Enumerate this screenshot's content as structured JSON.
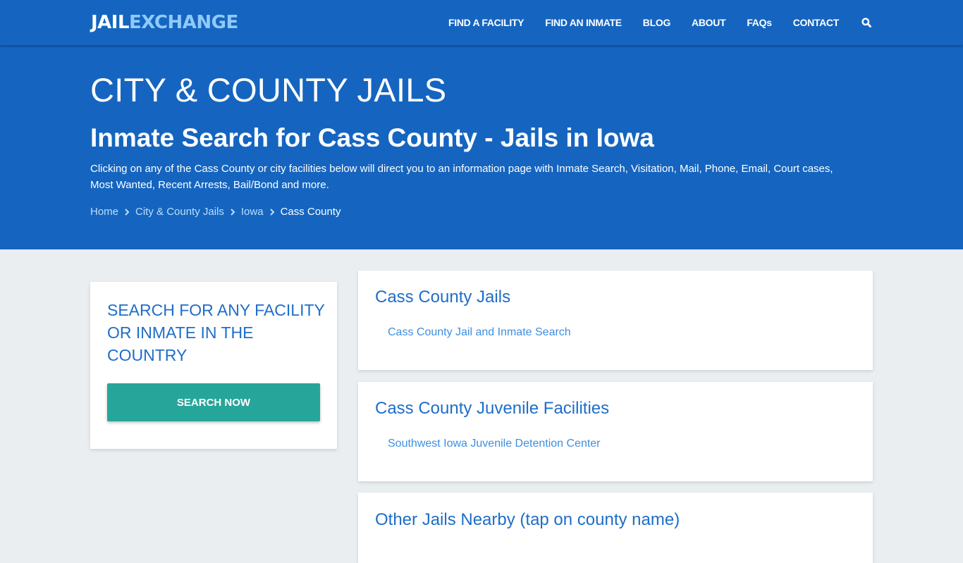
{
  "header": {
    "logo_part1": "JAIL",
    "logo_part2": "EXCHANGE",
    "nav": [
      {
        "label": "FIND A FACILITY"
      },
      {
        "label": "FIND AN INMATE"
      },
      {
        "label": "BLOG"
      },
      {
        "label": "ABOUT"
      },
      {
        "label": "FAQs"
      },
      {
        "label": "CONTACT"
      }
    ],
    "search_icon": "search-icon"
  },
  "hero": {
    "title": "CITY & COUNTY JAILS",
    "subtitle": "Inmate Search for Cass County - Jails in Iowa",
    "description": "Clicking on any of the Cass County or city facilities below will direct you to an information page with Inmate Search, Visitation, Mail, Phone, Email, Court cases, Most Wanted, Recent Arrests, Bail/Bond and more.",
    "breadcrumb": [
      {
        "label": "Home"
      },
      {
        "label": "City & County Jails"
      },
      {
        "label": "Iowa"
      },
      {
        "label": "Cass County"
      }
    ]
  },
  "sidebar": {
    "heading": "SEARCH FOR ANY FACILITY OR INMATE IN THE COUNTRY",
    "button_label": "SEARCH NOW"
  },
  "sections": [
    {
      "title": "Cass County Jails",
      "links": [
        "Cass County Jail and Inmate Search"
      ]
    },
    {
      "title": "Cass County Juvenile Facilities",
      "links": [
        "Southwest Iowa Juvenile Detention Center"
      ]
    },
    {
      "title": "Other Jails Nearby (tap on county name)",
      "links": []
    }
  ],
  "colors": {
    "brand_blue": "#1565c0",
    "logo_accent": "#90caf9",
    "heading_blue": "#1e6ec8",
    "link_blue": "#3d8fe0",
    "button_teal": "#26a69a",
    "page_bg": "#eaeef1"
  }
}
